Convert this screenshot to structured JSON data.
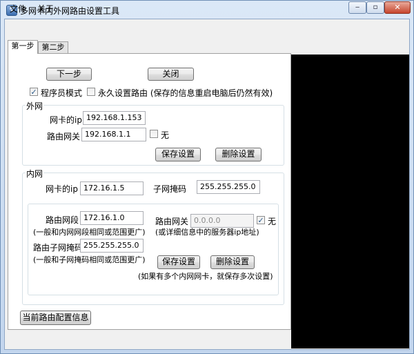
{
  "window": {
    "title": "多网卡内外网路由设置工具",
    "min_glyph": "‒",
    "max_glyph": "▫",
    "close_glyph": "✕",
    "icon_glyph": "↯"
  },
  "menu": {
    "file": "文件",
    "about": "关于"
  },
  "tabs": {
    "step1": "第一步",
    "step2": "第二步"
  },
  "buttons": {
    "next": "下一步",
    "close": "关闭",
    "show_config": "当前路由配置信息"
  },
  "options": {
    "programmer_mode": {
      "label": "程序员模式",
      "checked": true
    },
    "persistent_route": {
      "label": "永久设置路由 (保存的信息重启电脑后仍然有效)",
      "checked": false
    }
  },
  "wan": {
    "group_label": "外网",
    "nic_ip_label": "网卡的ip",
    "nic_ip": "192.168.1.153",
    "gateway_label": "路由网关",
    "gateway": "192.168.1.1",
    "none_label": "无",
    "none_checked": false,
    "save": "保存设置",
    "delete": "删除设置"
  },
  "lan": {
    "group_label": "内网",
    "nic_ip_label": "网卡的ip",
    "nic_ip": "172.16.1.5",
    "mask_label": "子网掩码",
    "mask": "255.255.255.0",
    "route_segment_label": "路由网段",
    "route_segment": "172.16.1.0",
    "route_segment_hint": "(一般和内网网段相同或范围更广)",
    "route_gateway_label": "路由网关",
    "route_gateway": "0.0.0.0",
    "route_gateway_hint": "(或详细信息中的服务器ip地址)",
    "none_label": "无",
    "none_checked": true,
    "route_mask_label": "路由子网掩码",
    "route_mask": "255.255.255.0",
    "route_mask_hint": "(一般和子网掩码相同或范围更广)",
    "save": "保存设置",
    "delete": "删除设置",
    "multi_hint": "(如果有多个内网网卡，就保存多次设置)"
  }
}
